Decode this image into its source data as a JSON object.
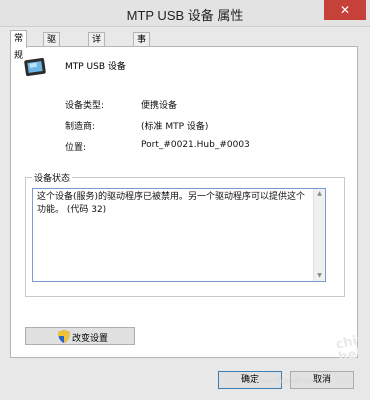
{
  "window": {
    "title": "MTP USB 设备 属性",
    "close_glyph": "✕"
  },
  "tabs": [
    {
      "label": "常规",
      "active": true
    },
    {
      "label": "驱动程序",
      "active": false
    },
    {
      "label": "详细信息",
      "active": false
    },
    {
      "label": "事件",
      "active": false
    }
  ],
  "device": {
    "name": "MTP USB 设备",
    "icon": "device-icon"
  },
  "properties": {
    "type_label": "设备类型:",
    "type_value": "便携设备",
    "manufacturer_label": "制造商:",
    "manufacturer_value": "(标准 MTP 设备)",
    "location_label": "位置:",
    "location_value": "Port_#0021.Hub_#0003"
  },
  "status": {
    "group_label": "设备状态",
    "text": "这个设备(服务)的驱动程序已被禁用。另一个驱动程序可以提供这个功能。 (代码 32)"
  },
  "buttons": {
    "change_settings": "改变设置",
    "ok": "确定",
    "cancel": "取消"
  },
  "watermark": {
    "logo_text": "chip hell",
    "url": "www.chiphell.com"
  }
}
